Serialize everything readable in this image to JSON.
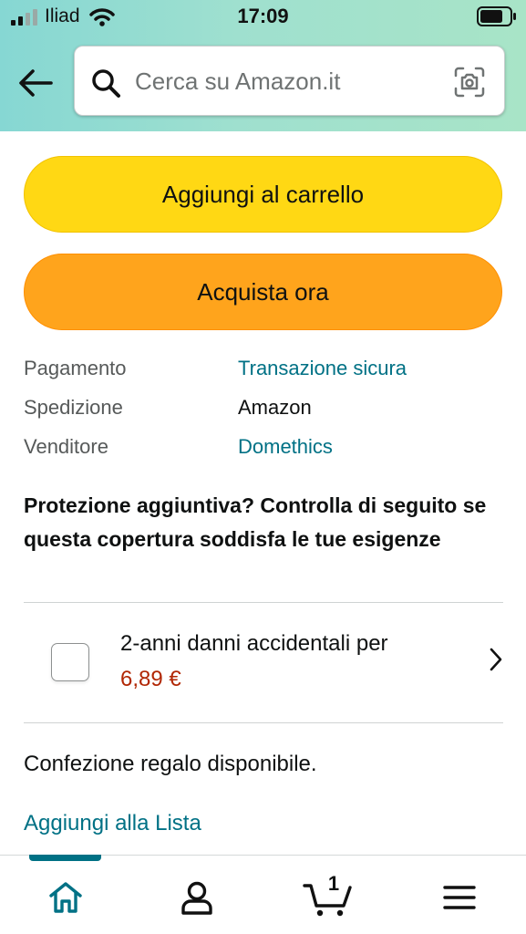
{
  "status_bar": {
    "carrier": "Iliad",
    "time": "17:09"
  },
  "search": {
    "placeholder": "Cerca su Amazon.it"
  },
  "buttons": {
    "add_to_cart": "Aggiungi al carrello",
    "buy_now": "Acquista ora"
  },
  "details": [
    {
      "label": "Pagamento",
      "value": "Transazione sicura"
    },
    {
      "label": "Spedizione",
      "value": "Amazon"
    },
    {
      "label": "Venditore",
      "value": "Domethics"
    }
  ],
  "protection": {
    "title": "Protezione aggiuntiva? Controlla di seguito se questa copertura soddisfa le tue esigenze",
    "option_text": "2-anni danni accidentali per",
    "option_price": "6,89 €",
    "checked": false
  },
  "gift_text": "Confezione regalo disponibile.",
  "add_to_list": "Aggiungi alla Lista",
  "tabbar": {
    "cart_count": "1",
    "active_tab": "home"
  },
  "colors": {
    "link": "#007185",
    "price": "#b12704",
    "add_to_cart_button": "#ffd814",
    "buy_now_button": "#ffa41c"
  }
}
